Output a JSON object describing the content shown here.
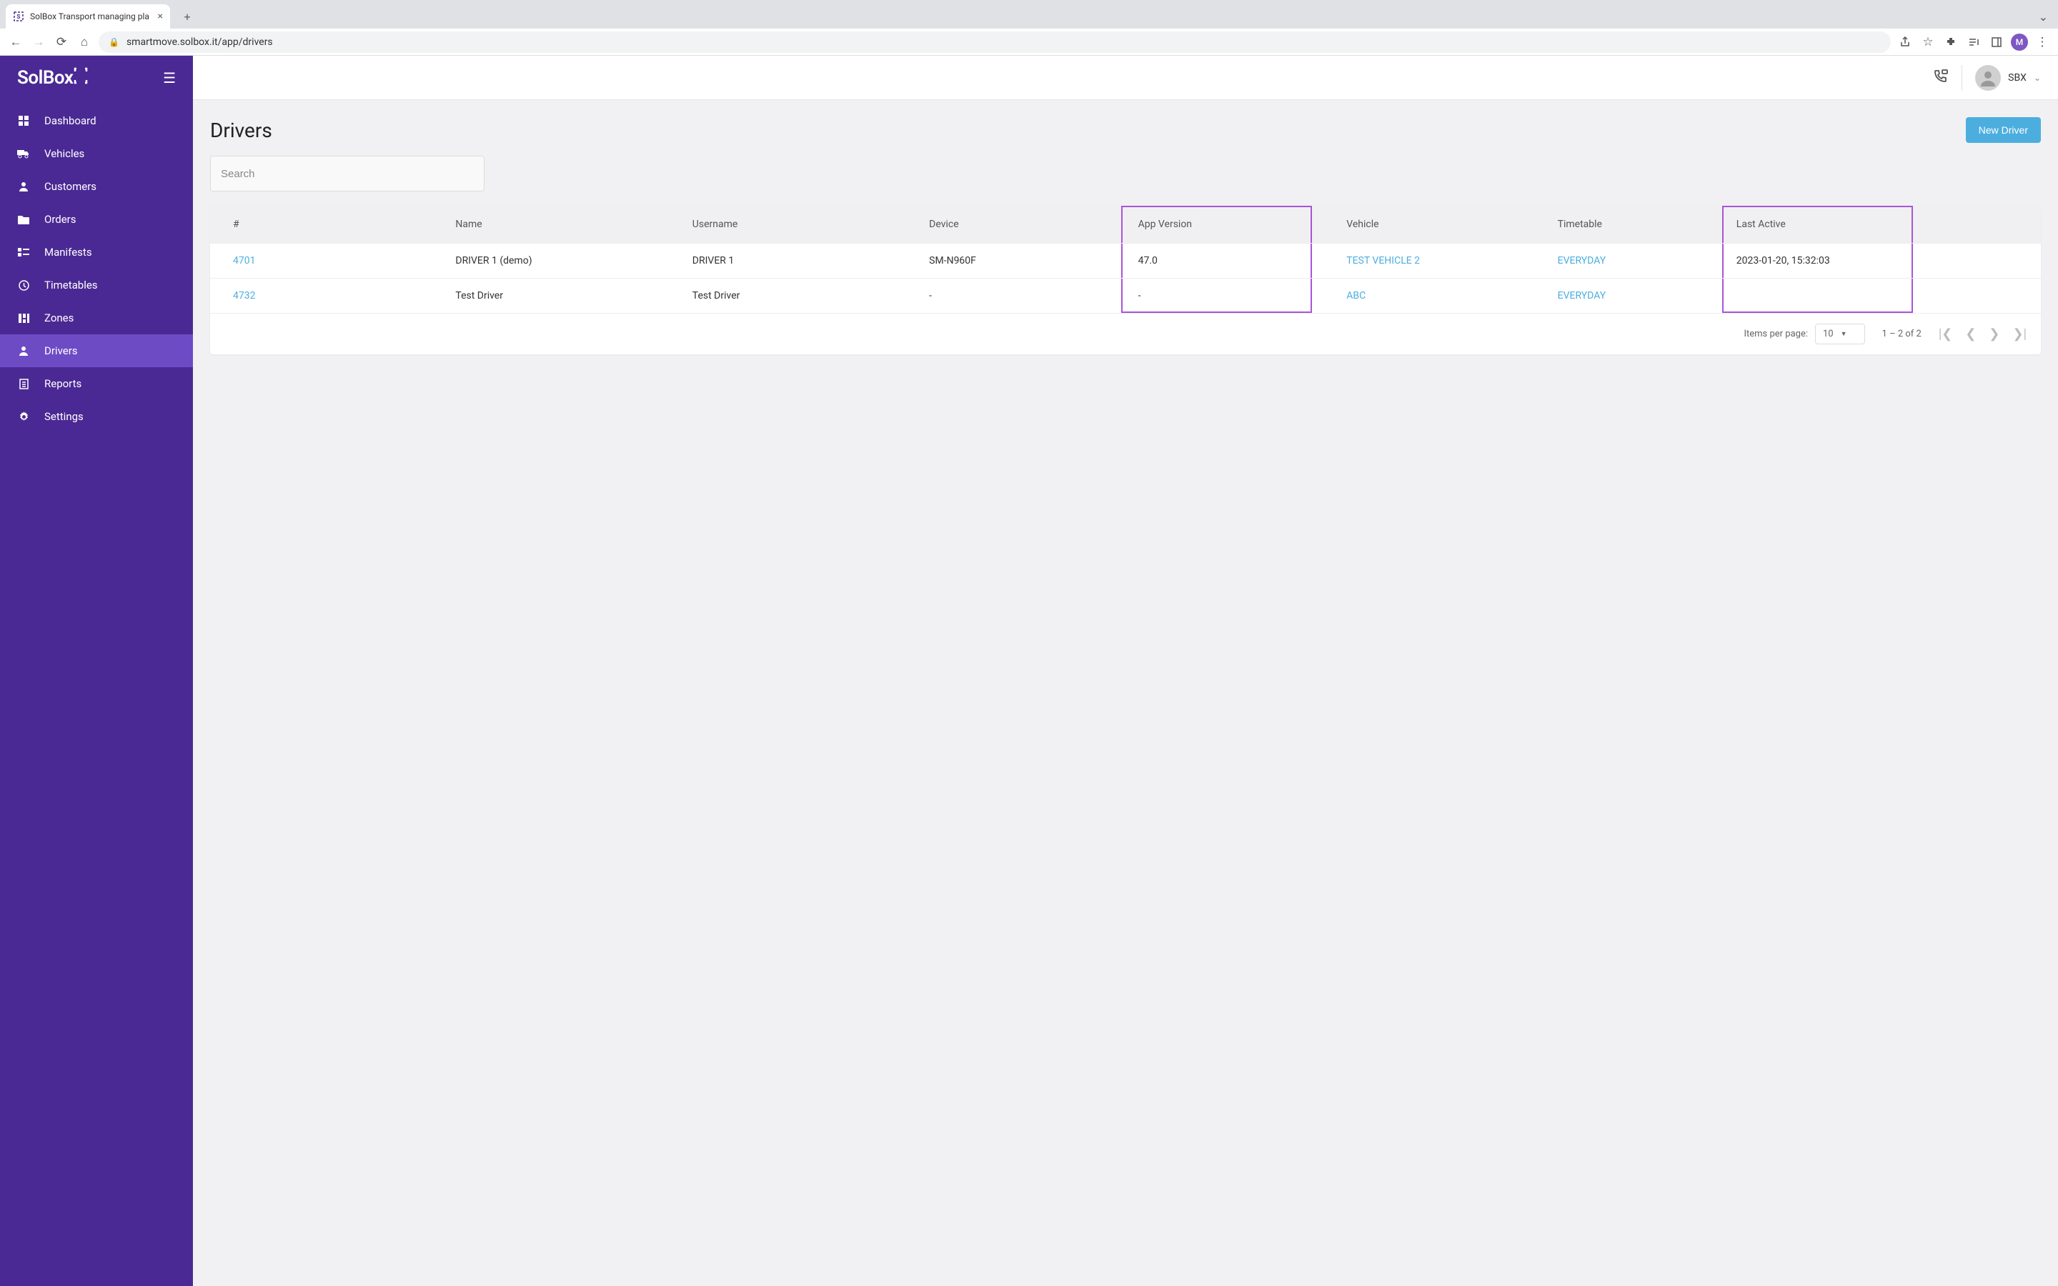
{
  "browser": {
    "tab_title": "SolBox Transport managing pla",
    "url": "smartmove.solbox.it/app/drivers",
    "avatar_letter": "M"
  },
  "sidebar": {
    "logo": "SolBox",
    "items": [
      {
        "label": "Dashboard",
        "icon": "dashboard"
      },
      {
        "label": "Vehicles",
        "icon": "truck"
      },
      {
        "label": "Customers",
        "icon": "person"
      },
      {
        "label": "Orders",
        "icon": "folder"
      },
      {
        "label": "Manifests",
        "icon": "list"
      },
      {
        "label": "Timetables",
        "icon": "clock"
      },
      {
        "label": "Zones",
        "icon": "grid"
      },
      {
        "label": "Drivers",
        "icon": "person",
        "active": true
      },
      {
        "label": "Reports",
        "icon": "report"
      },
      {
        "label": "Settings",
        "icon": "gear"
      }
    ]
  },
  "topbar": {
    "user_label": "SBX"
  },
  "page": {
    "title": "Drivers",
    "new_driver_label": "New Driver",
    "search_placeholder": "Search"
  },
  "table": {
    "headers": {
      "id": "#",
      "name": "Name",
      "username": "Username",
      "device": "Device",
      "app_version": "App Version",
      "vehicle": "Vehicle",
      "timetable": "Timetable",
      "last_active": "Last Active"
    },
    "rows": [
      {
        "id": "4701",
        "name": "DRIVER 1 (demo)",
        "username": "DRIVER 1",
        "device": "SM-N960F",
        "app_version": "47.0",
        "vehicle": "TEST VEHICLE 2",
        "timetable": "EVERYDAY",
        "last_active": "2023-01-20, 15:32:03"
      },
      {
        "id": "4732",
        "name": "Test Driver",
        "username": "Test Driver",
        "device": "-",
        "app_version": "-",
        "vehicle": "ABC",
        "timetable": "EVERYDAY",
        "last_active": ""
      }
    ],
    "footer": {
      "items_per_page_label": "Items per page:",
      "items_per_page_value": "10",
      "range": "1 – 2 of 2"
    }
  }
}
